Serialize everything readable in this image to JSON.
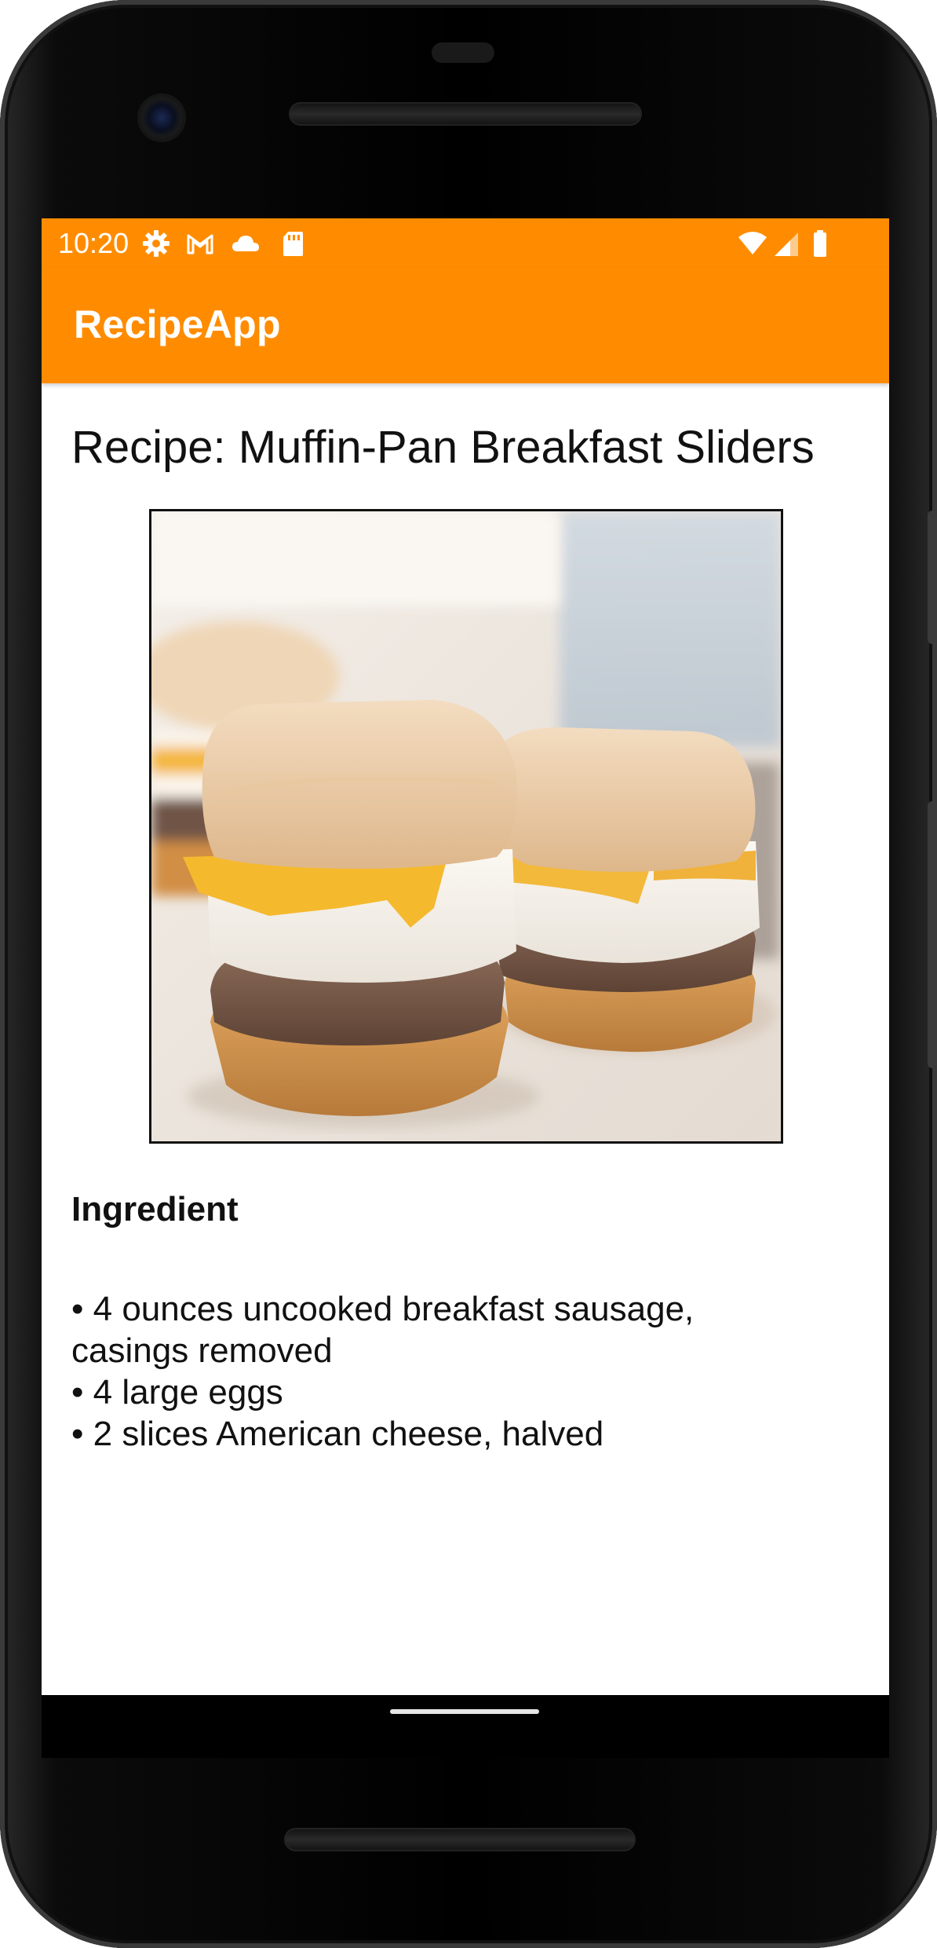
{
  "status_bar": {
    "time": "10:20",
    "left_icons": [
      "gear-icon",
      "gmail-icon",
      "cloud-icon",
      "sd-card-icon"
    ],
    "right_icons": [
      "wifi-icon",
      "signal-icon",
      "battery-icon"
    ],
    "color": "#ff8c00"
  },
  "app_bar": {
    "title": "RecipeApp",
    "color": "#ff8c00"
  },
  "recipe": {
    "title": "Recipe: Muffin-Pan Breakfast Sliders",
    "image_name": "breakfast-sliders-photo",
    "ingredient_heading": "Ingredient",
    "ingredients": [
      "• 4 ounces uncooked breakfast sausage,",
      "casings removed",
      "• 4 large eggs",
      "• 2 slices American cheese, halved"
    ]
  },
  "nav_bar": {
    "home_indicator": "home-pill"
  }
}
